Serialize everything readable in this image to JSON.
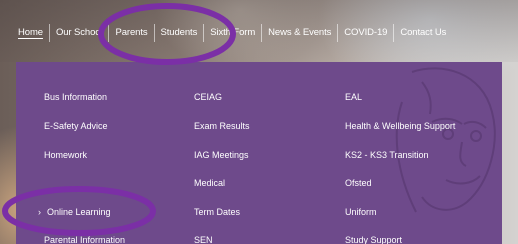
{
  "nav": {
    "items": [
      "Home",
      "Our School",
      "Parents",
      "Students",
      "Sixth Form",
      "News & Events",
      "COVID-19",
      "Contact Us"
    ],
    "active": "Home"
  },
  "menu": {
    "col1": [
      "Bus Information",
      "E-Safety Advice",
      "Homework",
      "",
      "Online Learning",
      "Parental Information"
    ],
    "col2": [
      "CEIAG",
      "Exam Results",
      "IAG Meetings",
      "Medical",
      "Term Dates",
      "SEN"
    ],
    "col3": [
      "EAL",
      "Health & Wellbeing Support",
      "KS2 - KS3 Transition",
      "Ofsted",
      "Uniform",
      "Study Support"
    ],
    "highlighted": "Online Learning",
    "chevron_icon": "chevron-right-icon"
  },
  "colors": {
    "panel": "#6e4a8b",
    "annotation_ring": "#7b2fa6",
    "text": "#ffffff"
  }
}
